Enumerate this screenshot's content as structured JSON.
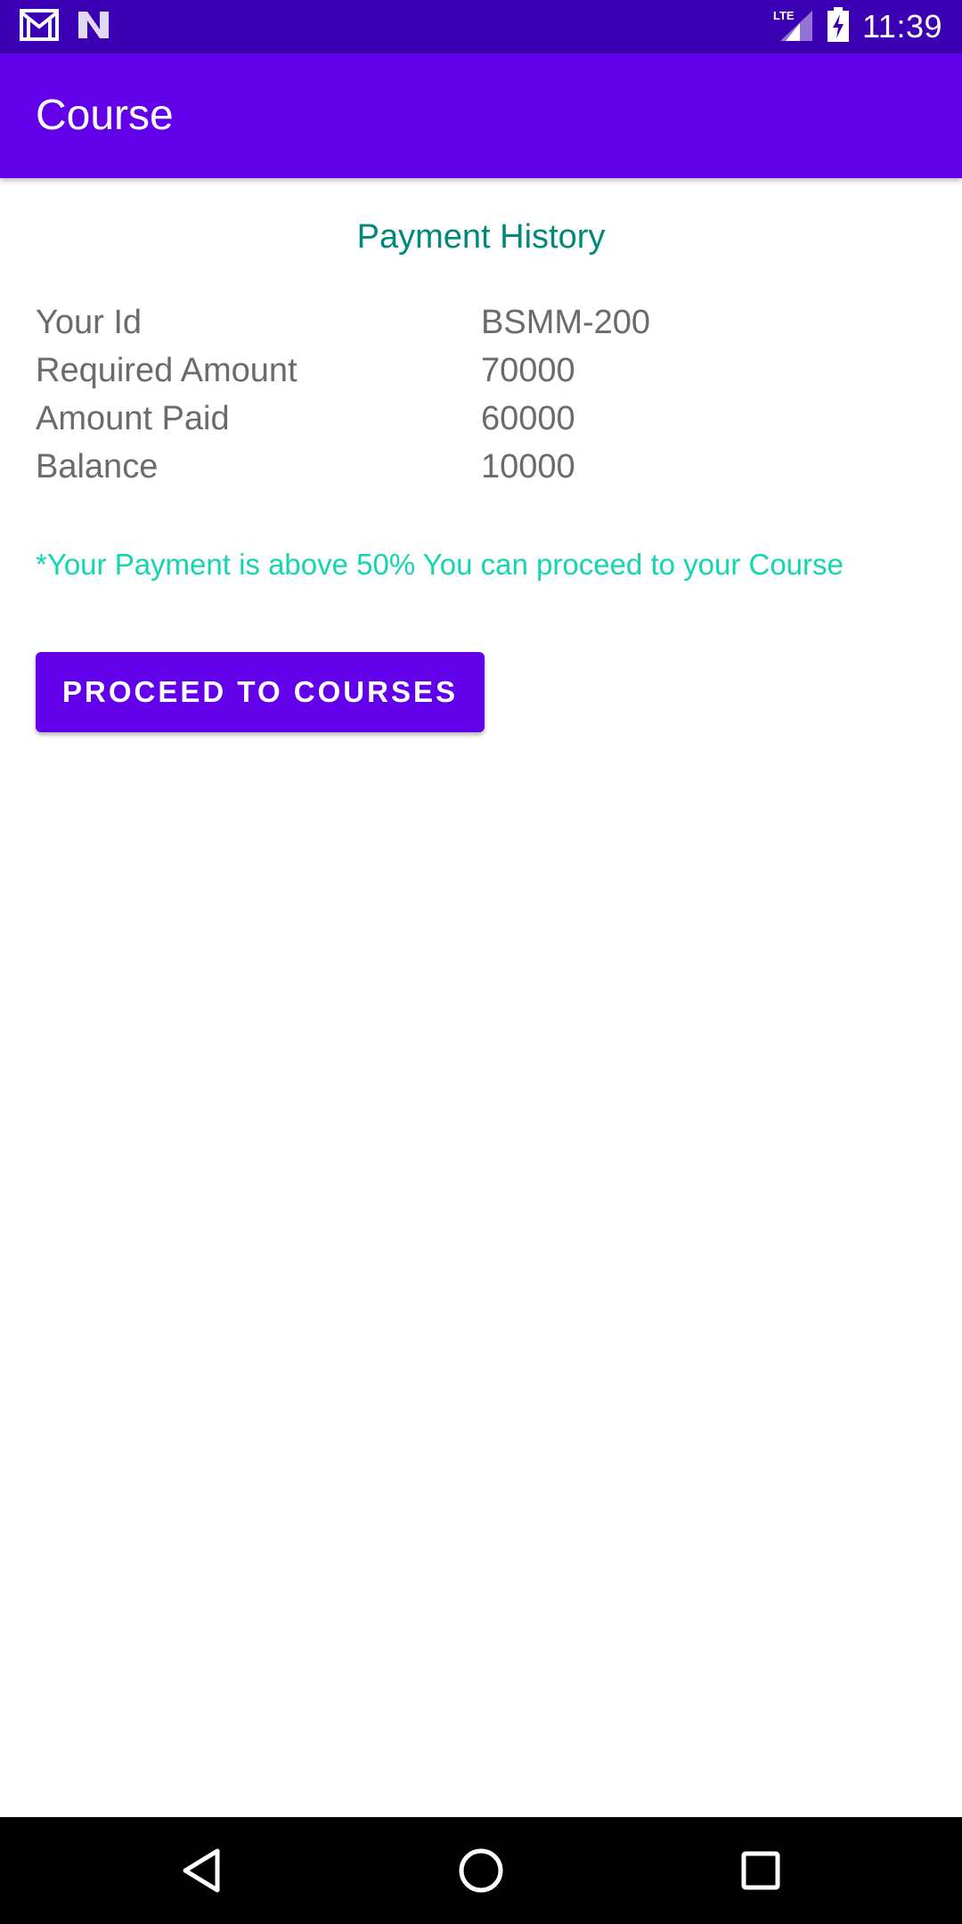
{
  "status_bar": {
    "time": "11:39",
    "left_icons": [
      "gmail-icon",
      "n-notification-icon"
    ],
    "right_icons": [
      "lte-signal-icon",
      "battery-charging-icon"
    ],
    "network_label": "LTE"
  },
  "app_bar": {
    "title": "Course"
  },
  "payment": {
    "section_title": "Payment History",
    "rows": [
      {
        "label": "Your Id",
        "value": "BSMM-200"
      },
      {
        "label": "Required Amount",
        "value": "70000"
      },
      {
        "label": "Amount Paid",
        "value": "60000"
      },
      {
        "label": "Balance",
        "value": "10000"
      }
    ],
    "notice": "*Your Payment is above 50% You can proceed to your Course",
    "button_label": "PROCEED TO COURSES"
  },
  "nav_bar": {
    "icons": [
      "back-icon",
      "home-icon",
      "recents-icon"
    ]
  },
  "colors": {
    "status_bar": "#3b00b3",
    "app_bar": "#6200ea",
    "section_title": "#00897b",
    "notice": "#13d6b0",
    "label_text": "#6b6b6b",
    "button": "#6200ea"
  }
}
